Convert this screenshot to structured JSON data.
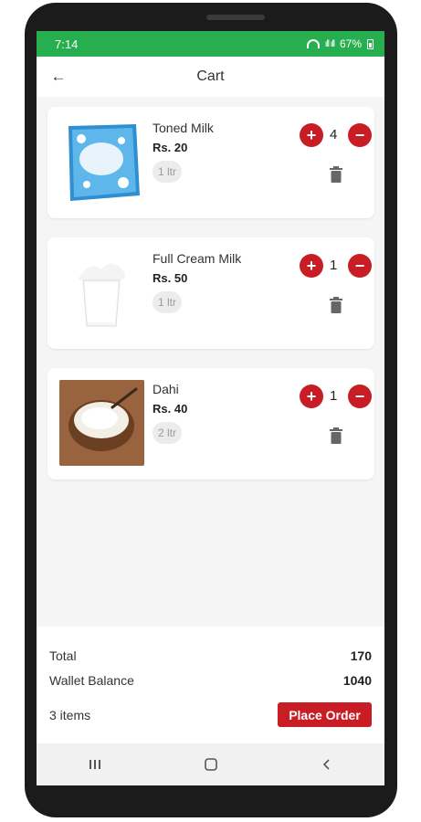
{
  "status_bar": {
    "time": "7:14",
    "signal_text": "ıll ıll",
    "battery_percent": "67%"
  },
  "app_bar": {
    "title": "Cart",
    "back_icon": "arrow-left-icon"
  },
  "cart_items": [
    {
      "name": "Toned Milk",
      "price": "Rs. 20",
      "unit": "1 ltr",
      "quantity": "4"
    },
    {
      "name": "Full Cream Milk",
      "price": "Rs. 50",
      "unit": "1 ltr",
      "quantity": "1"
    },
    {
      "name": "Dahi",
      "price": "Rs. 40",
      "unit": "2 ltr",
      "quantity": "1"
    }
  ],
  "summary": {
    "total_label": "Total",
    "total_value": "170",
    "wallet_label": "Wallet Balance",
    "wallet_value": "1040",
    "items_count": "3 items",
    "place_order_label": "Place Order"
  },
  "colors": {
    "status_bar": "#27ae4f",
    "accent": "#c81d25"
  }
}
